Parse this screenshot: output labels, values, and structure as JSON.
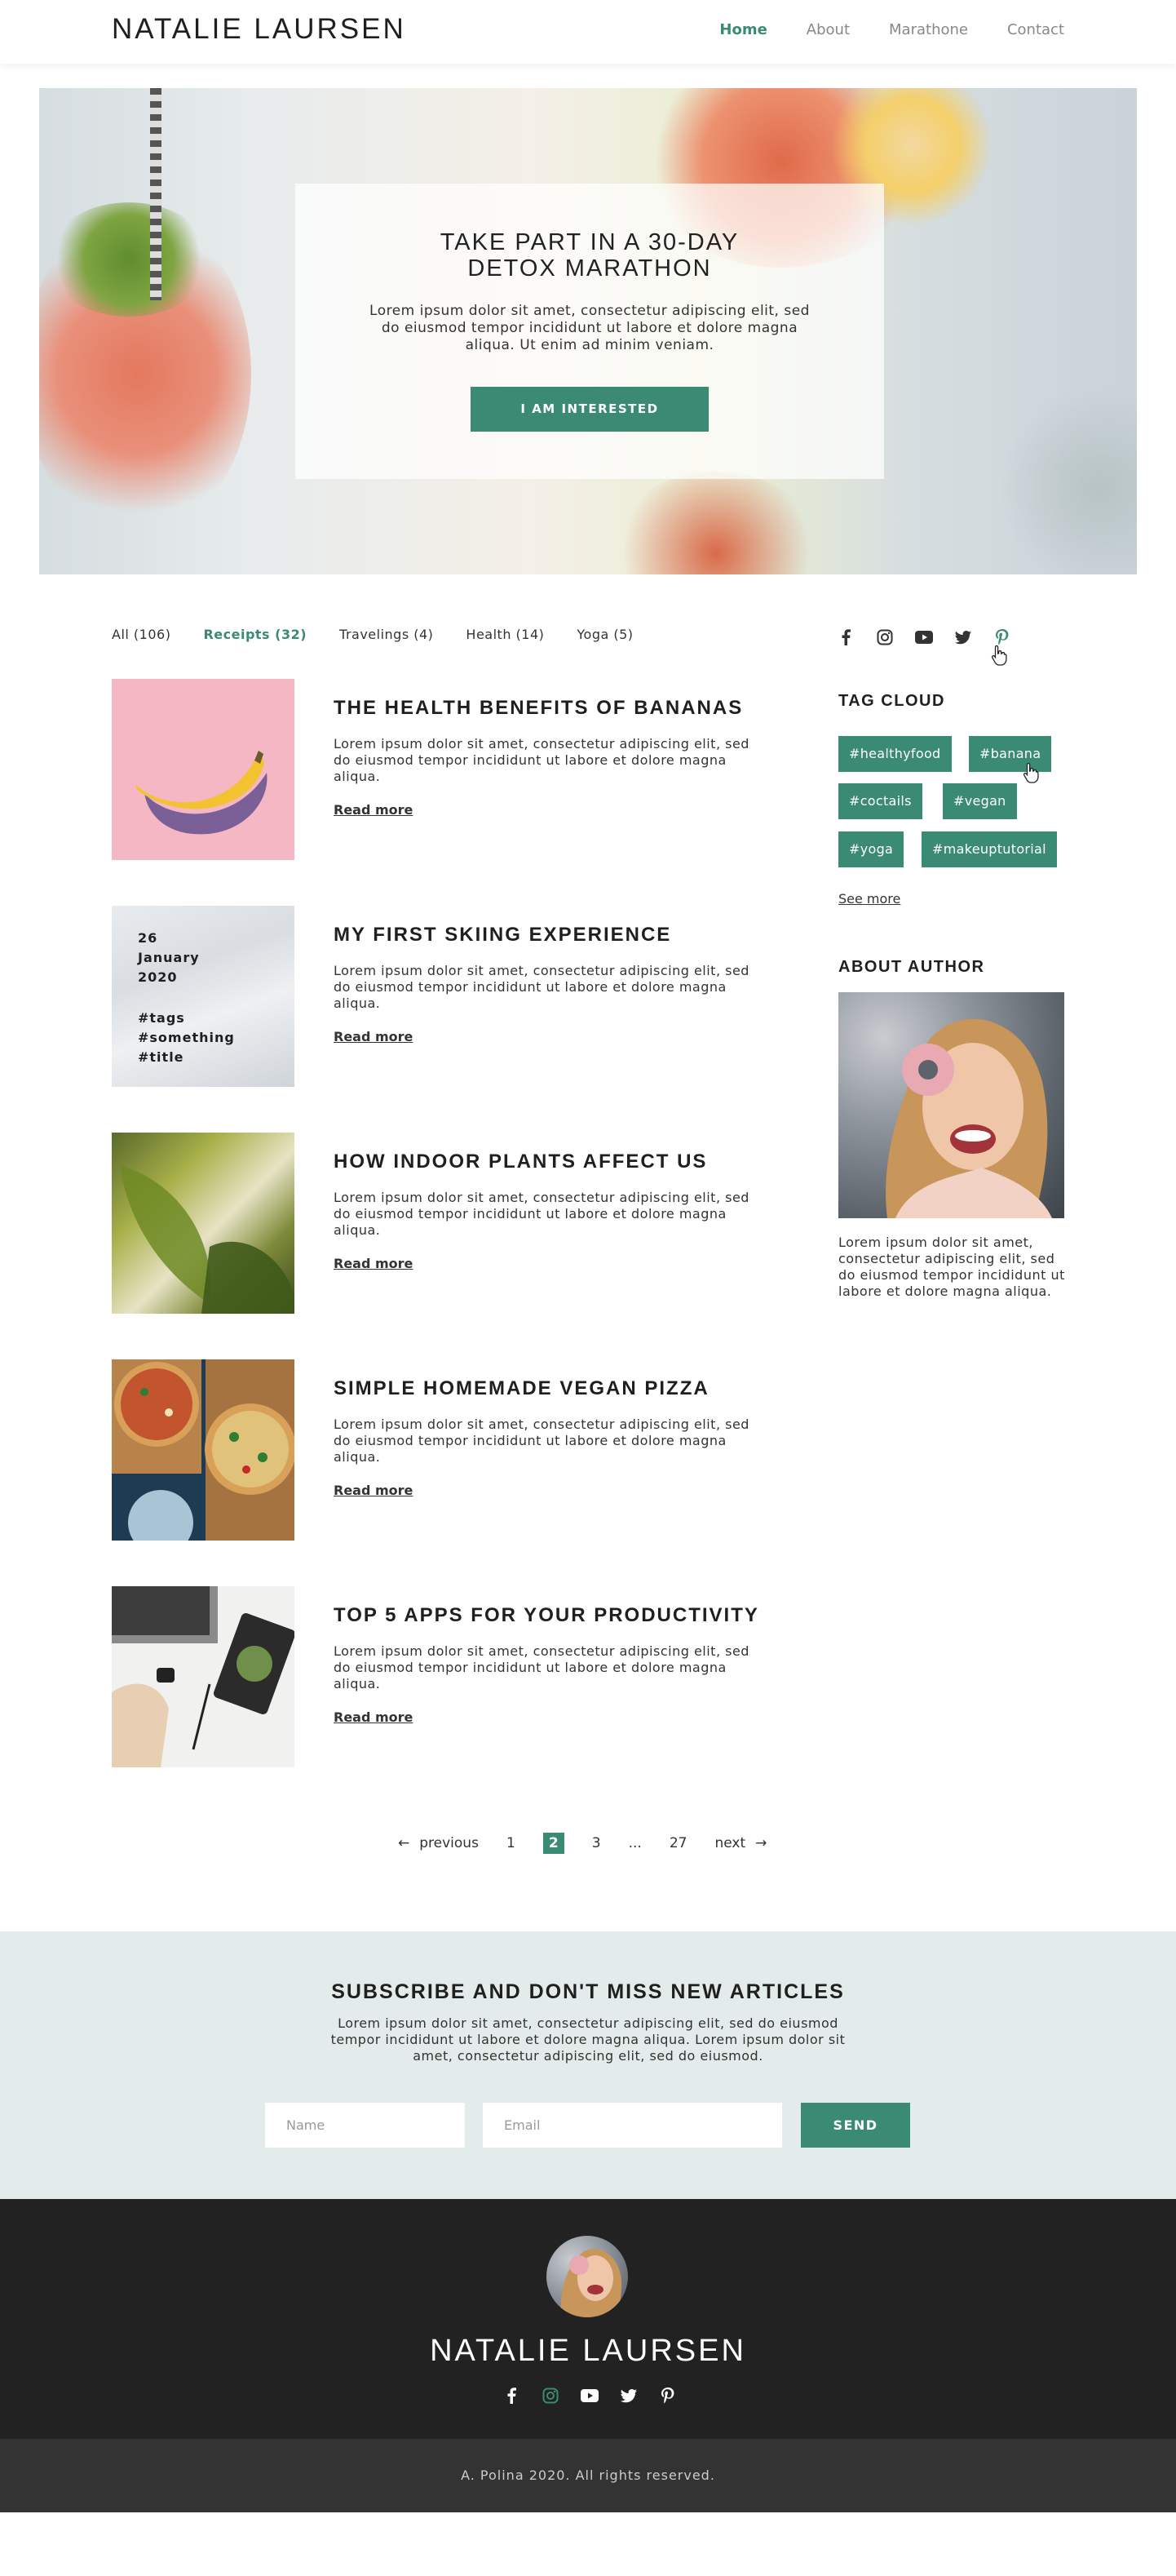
{
  "header": {
    "logo": "NATALIE LAURSEN",
    "nav": [
      "Home",
      "About",
      "Marathone",
      "Contact"
    ]
  },
  "hero": {
    "title": "TAKE PART IN A 30-DAY DETOX MARATHON",
    "text": "Lorem ipsum dolor sit amet, consectetur adipiscing elit, sed do eiusmod tempor incididunt ut labore et dolore magna aliqua. Ut enim ad minim veniam.",
    "button": "I AM INTERESTED"
  },
  "filters": [
    "All (106)",
    "Receipts (32)",
    "Travelings (4)",
    "Health (14)",
    "Yoga (5)"
  ],
  "posts": [
    {
      "title": "THE HEALTH BENEFITS OF BANANAS",
      "text": "Lorem ipsum dolor sit amet, consectetur adipiscing elit, sed do eiusmod tempor incididunt ut labore et dolore magna aliqua.",
      "more": "Read more"
    },
    {
      "title": "MY FIRST SKIING EXPERIENCE",
      "text": "Lorem ipsum dolor sit amet, consectetur adipiscing elit, sed do eiusmod tempor incididunt ut labore et dolore magna aliqua.",
      "more": "Read more",
      "overlay": {
        "day": "26",
        "month": "January",
        "year": "2020",
        "tags": [
          "#tags",
          "#something",
          "#title"
        ]
      }
    },
    {
      "title": "HOW INDOOR PLANTS AFFECT US",
      "text": "Lorem ipsum dolor sit amet, consectetur adipiscing elit, sed do eiusmod tempor incididunt ut labore et dolore magna aliqua.",
      "more": "Read more"
    },
    {
      "title": "SIMPLE HOMEMADE VEGAN PIZZA",
      "text": "Lorem ipsum dolor sit amet, consectetur adipiscing elit, sed do eiusmod tempor incididunt ut labore et dolore magna aliqua.",
      "more": "Read more"
    },
    {
      "title": "TOP 5 APPS FOR YOUR PRODUCTIVITY",
      "text": "Lorem ipsum dolor sit amet, consectetur adipiscing elit, sed do eiusmod tempor incididunt ut labore et dolore magna aliqua.",
      "more": "Read more"
    }
  ],
  "pagination": {
    "prev": "previous",
    "pages": [
      "1",
      "2",
      "3",
      "...",
      "27"
    ],
    "current": "2",
    "next": "next"
  },
  "sidebar": {
    "social_icons": [
      "facebook-icon",
      "instagram-icon",
      "youtube-icon",
      "twitter-icon",
      "pinterest-icon"
    ],
    "tag_cloud_title": "TAG CLOUD",
    "tags": [
      "#healthyfood",
      "#banana",
      "#coctails",
      "#vegan",
      "#yoga",
      "#makeuptutorial"
    ],
    "see_more": "See more",
    "about_title": "ABOUT AUTHOR",
    "bio": "Lorem ipsum dolor sit amet, consectetur adipiscing elit, sed do eiusmod tempor incididunt ut labore et dolore magna aliqua."
  },
  "subscribe": {
    "title": "SUBSCRIBE AND DON'T MISS NEW ARTICLES",
    "text": "Lorem ipsum dolor sit amet, consectetur adipiscing elit, sed do eiusmod tempor incididunt ut labore et dolore magna aliqua.  Lorem ipsum dolor sit amet, consectetur adipiscing elit, sed do eiusmod.",
    "name_placeholder": "Name",
    "email_placeholder": "Email",
    "button": "SEND"
  },
  "footer": {
    "name": "NATALIE LAURSEN",
    "copyright": "A. Polina 2020. All rights reserved."
  },
  "colors": {
    "accent": "#3a8a74",
    "subscribe_bg": "#e3ecea",
    "footer_bg": "#222222"
  }
}
